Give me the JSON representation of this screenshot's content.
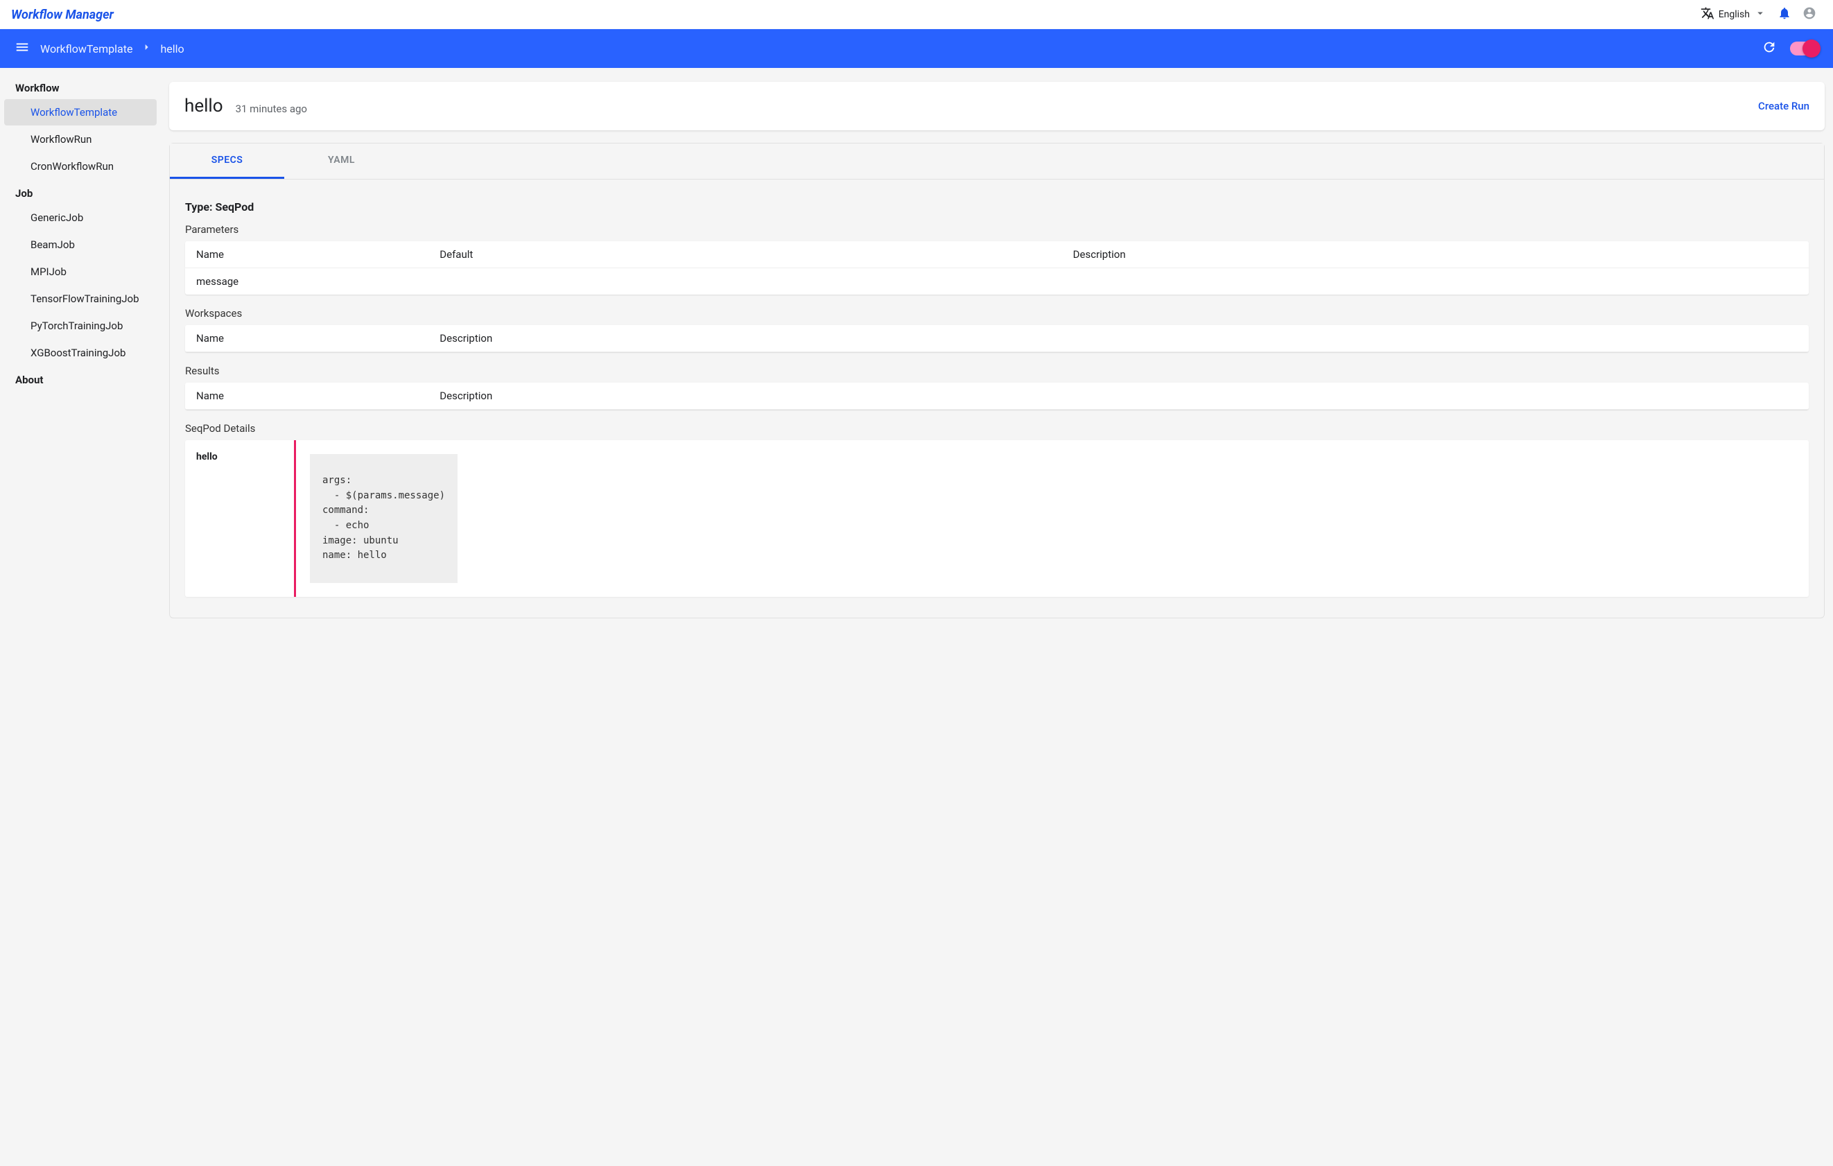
{
  "header": {
    "app_title": "Workflow Manager",
    "language": "English"
  },
  "bluebar": {
    "breadcrumb": [
      "WorkflowTemplate",
      "hello"
    ]
  },
  "sidebar": {
    "groups": [
      {
        "title": "Workflow",
        "items": [
          {
            "label": "WorkflowTemplate",
            "active": true
          },
          {
            "label": "WorkflowRun"
          },
          {
            "label": "CronWorkflowRun"
          }
        ]
      },
      {
        "title": "Job",
        "items": [
          {
            "label": "GenericJob"
          },
          {
            "label": "BeamJob"
          },
          {
            "label": "MPIJob"
          },
          {
            "label": "TensorFlowTrainingJob"
          },
          {
            "label": "PyTorchTrainingJob"
          },
          {
            "label": "XGBoostTrainingJob"
          }
        ]
      },
      {
        "title": "About",
        "items": []
      }
    ]
  },
  "workflow": {
    "name": "hello",
    "timestamp": "31 minutes ago",
    "create_run_label": "Create Run"
  },
  "tabs": {
    "specs": "SPECS",
    "yaml": "YAML"
  },
  "specs": {
    "type_label": "Type: SeqPod",
    "parameters": {
      "title": "Parameters",
      "columns": [
        "Name",
        "Default",
        "Description"
      ],
      "rows": [
        {
          "name": "message",
          "default": "",
          "description": ""
        }
      ]
    },
    "workspaces": {
      "title": "Workspaces",
      "columns": [
        "Name",
        "Description"
      ],
      "rows": []
    },
    "results": {
      "title": "Results",
      "columns": [
        "Name",
        "Description"
      ],
      "rows": []
    },
    "details": {
      "title": "SeqPod Details",
      "step_name": "hello",
      "code": "args:\n  - $(params.message)\ncommand:\n  - echo\nimage: ubuntu\nname: hello"
    }
  }
}
